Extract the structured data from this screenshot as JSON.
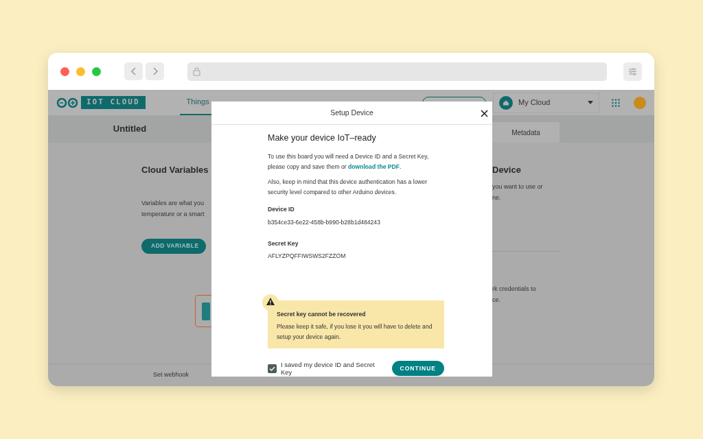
{
  "app": {
    "logo_text": "IOT CLOUD",
    "nav": [
      {
        "label": "Things",
        "selected": true
      }
    ],
    "workspace": "My Cloud"
  },
  "thing": {
    "title": "Untitled",
    "tabs": [
      {
        "label": "Metadata",
        "selected": false
      }
    ]
  },
  "left_pane": {
    "heading": "Cloud Variables",
    "lines": [
      "Variables are what you",
      "temperature or a smart"
    ],
    "button": "ADD VARIABLE"
  },
  "right_pane": {
    "heading": "Device",
    "lines": [
      "you want to use or",
      "ne."
    ],
    "lines_2": [
      "rk credentials to",
      "ce."
    ]
  },
  "footer": {
    "link": "Set webhook"
  },
  "modal": {
    "title": "Setup Device",
    "heading": "Make your device IoT–ready",
    "paragraphs": [
      {
        "text": "To use this board you will need a Device ID and a Secret Key, please copy and save them or ",
        "link": "download the PDF",
        "after": "."
      },
      {
        "text": "Also, keep in mind that this device authentication has a lower security level compared to other Arduino devices."
      }
    ],
    "fields": [
      {
        "label": "Device ID",
        "value": "b354ce33-6e22-458b-b990-b28b1d484243"
      },
      {
        "label": "Secret Key",
        "value": "AFLYZPQFFIWSWS2FZZOM"
      }
    ],
    "warning": {
      "title": "Secret key cannot be recovered",
      "text": "Please keep it safe, if you lose it you will have to delete and setup your device again."
    },
    "confirm": {
      "label": "I saved my device ID and Secret Key",
      "checked": true
    },
    "button": "CONTINUE"
  }
}
